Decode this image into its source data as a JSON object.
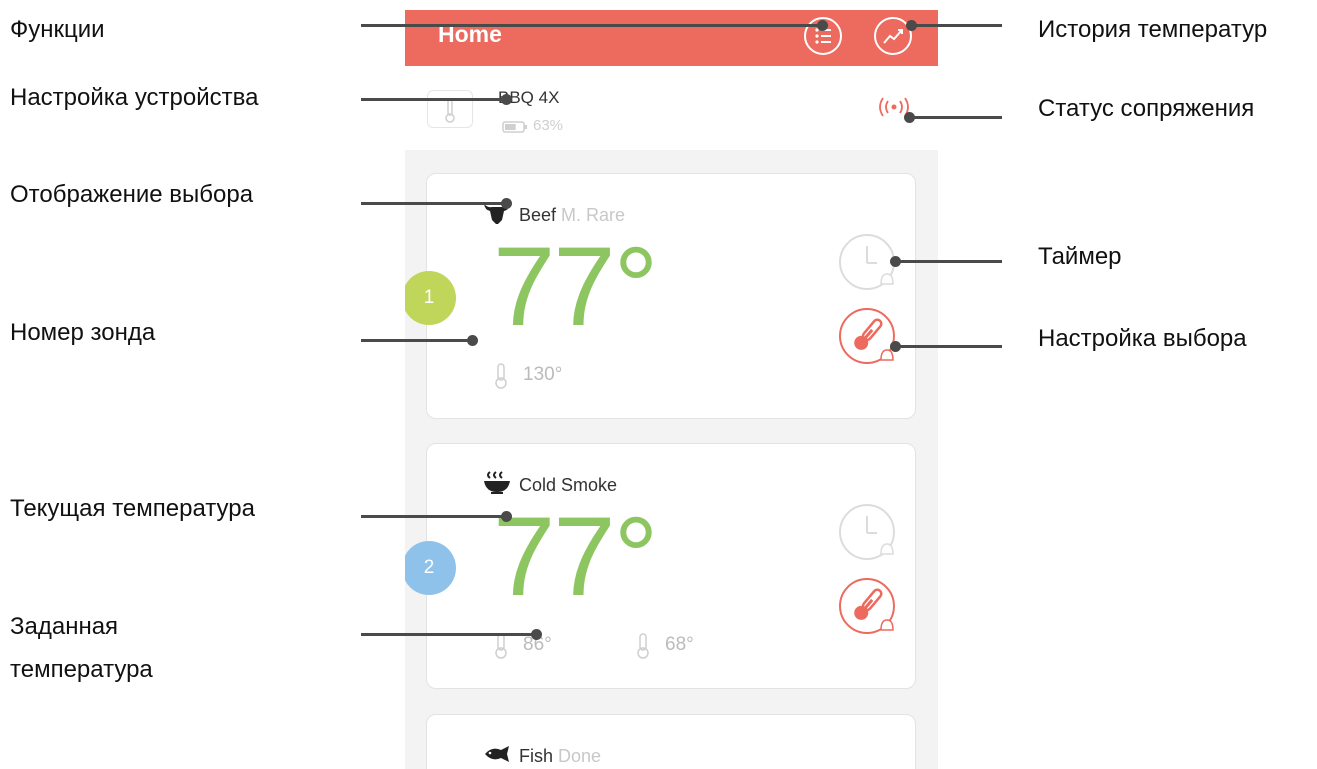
{
  "app": {
    "header_title": "Home",
    "device": {
      "name": "BBQ 4X",
      "battery": "63%",
      "battery_level": 0.63
    },
    "probes": [
      {
        "number": "1",
        "food": "Beef",
        "doneness": "M. Rare",
        "current_temp": "77°",
        "targets": [
          "130°"
        ],
        "badge_color": "#bfd65a"
      },
      {
        "number": "2",
        "food": "Cold Smoke",
        "doneness": "",
        "current_temp": "77°",
        "targets": [
          "86°",
          "68°"
        ],
        "badge_color": "#8ec2ea"
      },
      {
        "food": "Fish",
        "doneness": "Done"
      }
    ],
    "colors": {
      "header": "#ec6a5e",
      "temperature": "#8dc661",
      "accent": "#ec6a5e"
    },
    "icons": {
      "menu": "list-icon",
      "history": "trend-chart-icon",
      "pairing": "signal-waves-icon",
      "timer": "clock-bell-icon",
      "setting": "thermometer-bell-icon",
      "target": "thermometer-icon"
    }
  },
  "annotations": {
    "functions": "Функции",
    "device_settings": "Настройка устройства",
    "selection_display": "Отображение выбора",
    "probe_number": "Номер зонда",
    "current_temperature": "Текущая температура",
    "target_temperature_line1": "Заданная",
    "target_temperature_line2": "температура",
    "temperature_history": "История температур",
    "pairing_status": "Статус сопряжения",
    "timer": "Таймер",
    "selection_settings": "Настройка выбора"
  }
}
